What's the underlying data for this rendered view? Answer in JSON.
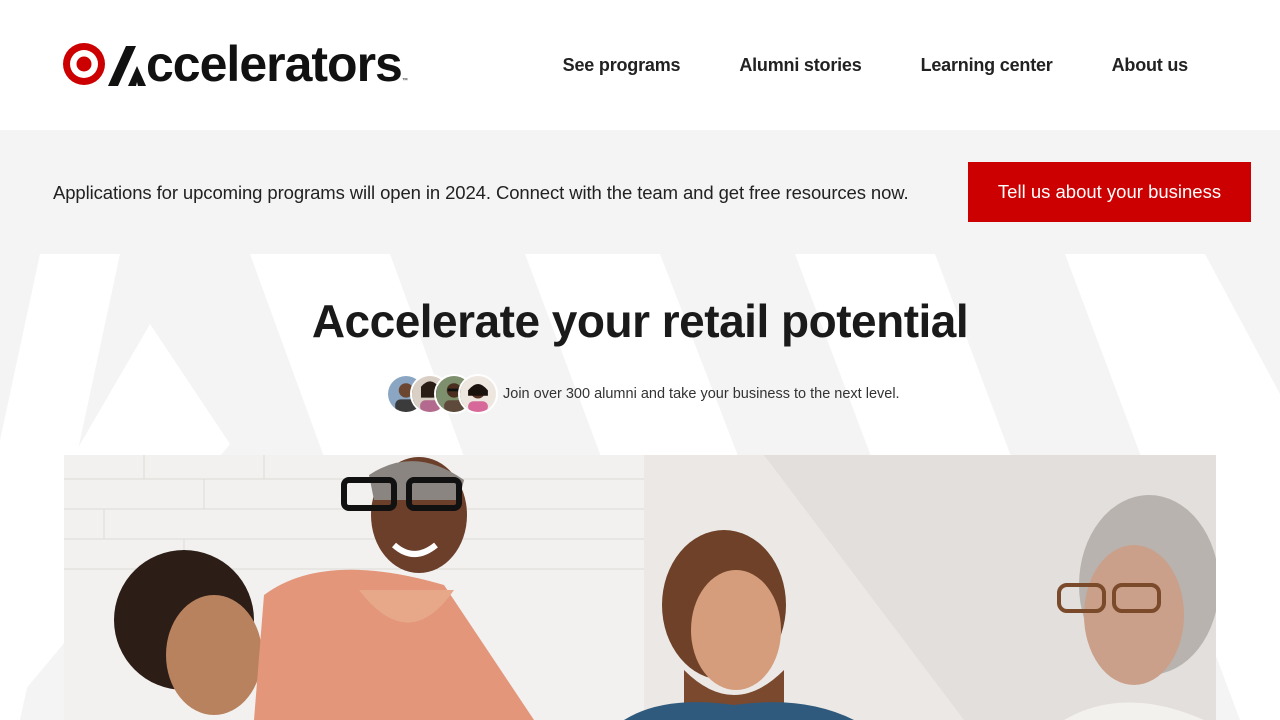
{
  "header": {
    "logo_text": "ccelerators",
    "logo_tm": "™",
    "nav": [
      "See programs",
      "Alumni stories",
      "Learning center",
      "About us"
    ]
  },
  "banner": {
    "text": "Applications for upcoming programs will open in 2024. Connect with the team and get free resources now.",
    "cta_label": "Tell us about your business"
  },
  "hero": {
    "title": "Accelerate your retail potential",
    "alumni_text": "Join over 300 alumni and take your business to the next level."
  },
  "colors": {
    "brand_red": "#cc0000",
    "banner_bg": "#f4f4f4",
    "text": "#1a1a1a"
  }
}
